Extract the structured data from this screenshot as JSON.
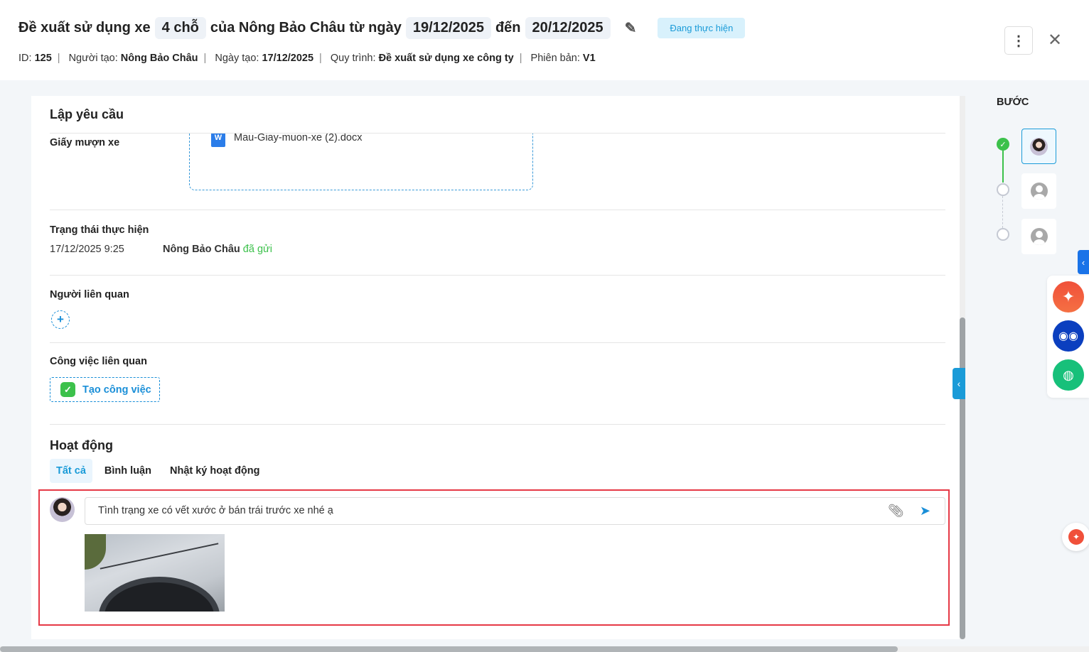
{
  "header": {
    "title_parts": [
      "Đề xuất sử dụng xe",
      "4 chỗ",
      "của Nông Bảo Châu từ ngày",
      "19/12/2025",
      "đến",
      "20/12/2025"
    ],
    "status": "Đang thực hiện",
    "meta": {
      "id_label": "ID:",
      "id": "125",
      "creator_label": "Người tạo:",
      "creator": "Nông Bảo Châu",
      "created_label": "Ngày tạo:",
      "created": "17/12/2025",
      "process_label": "Quy trình:",
      "process": "Đề xuất sử dụng xe công ty",
      "version_label": "Phiên bản:",
      "version": "V1",
      "sep": "|"
    },
    "more_icon": "⋮",
    "close_icon": "✕"
  },
  "card": {
    "title": "Lập yêu cầu",
    "attachment_label": "Giấy mượn xe",
    "attachment_file": "Mau-Giay-muon-xe (2).docx",
    "file_icon_letter": "W",
    "status_section": {
      "label": "Trạng thái thực hiện",
      "time": "17/12/2025 9:25",
      "actor": "Nông Bảo Châu",
      "action": "đã gửi"
    },
    "related_people_label": "Người liên quan",
    "related_tasks_label": "Công việc liên quan",
    "create_task_button": "Tạo công việc",
    "activity": {
      "title": "Hoạt động",
      "tabs": [
        "Tất cả",
        "Bình luận",
        "Nhật ký hoạt động"
      ],
      "active_tab": 0,
      "comment_text": "Tình trạng xe có vết xước ở bán trái trước xe nhé ạ"
    }
  },
  "steps": {
    "title": "BƯỚC",
    "items": [
      {
        "state": "done"
      },
      {
        "state": "pending"
      },
      {
        "state": "pending"
      }
    ]
  },
  "colors": {
    "accent": "#1a9bd8",
    "success": "#3cc14b",
    "highlight": "#e63946"
  }
}
